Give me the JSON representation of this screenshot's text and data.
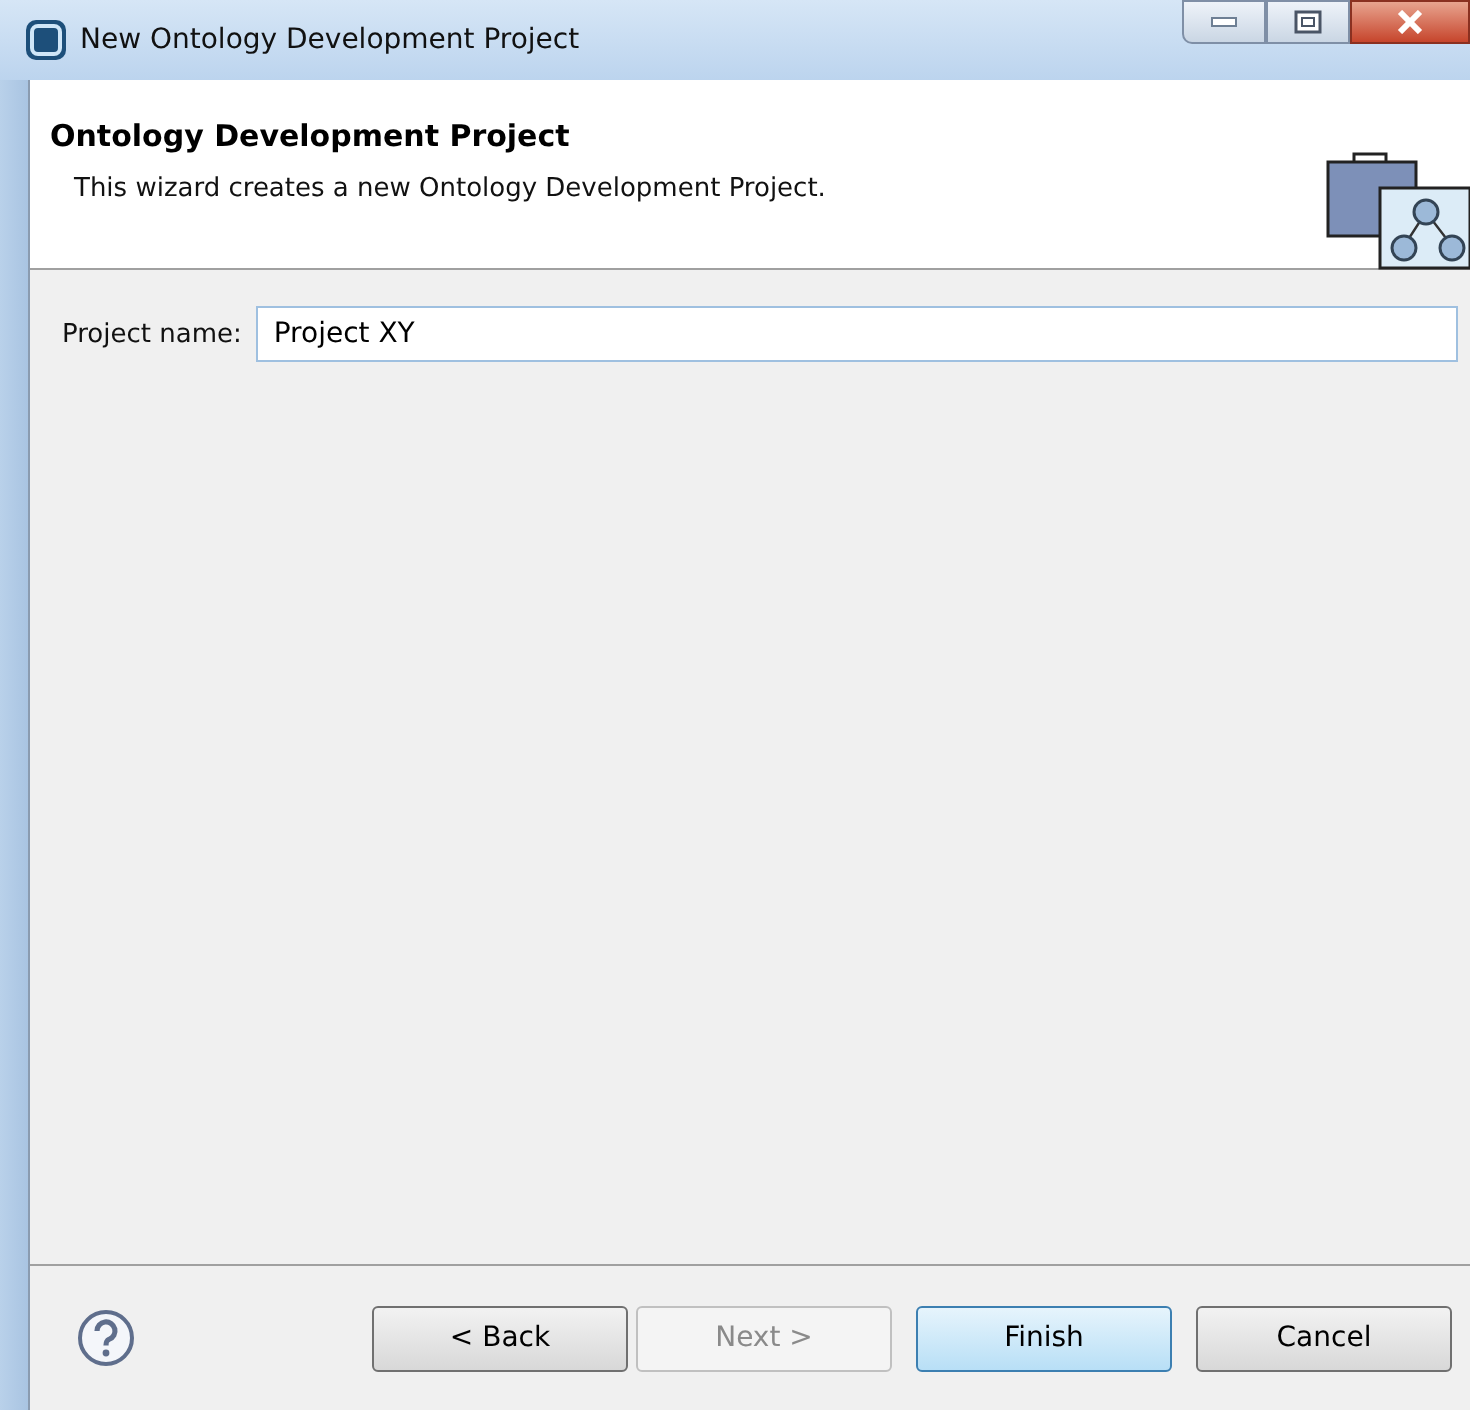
{
  "window": {
    "title": "New Ontology Development Project"
  },
  "header": {
    "title": "Ontology Development Project",
    "description": "This wizard creates a new Ontology Development Project."
  },
  "form": {
    "label": "Project name:",
    "value": "Project XY"
  },
  "buttons": [
    {
      "label": "< Back",
      "disabled": false,
      "default": false
    },
    {
      "label": "Next >",
      "disabled": true,
      "default": false
    },
    {
      "label": "Finish",
      "disabled": false,
      "default": true
    },
    {
      "label": "Cancel",
      "disabled": false,
      "default": false
    }
  ]
}
